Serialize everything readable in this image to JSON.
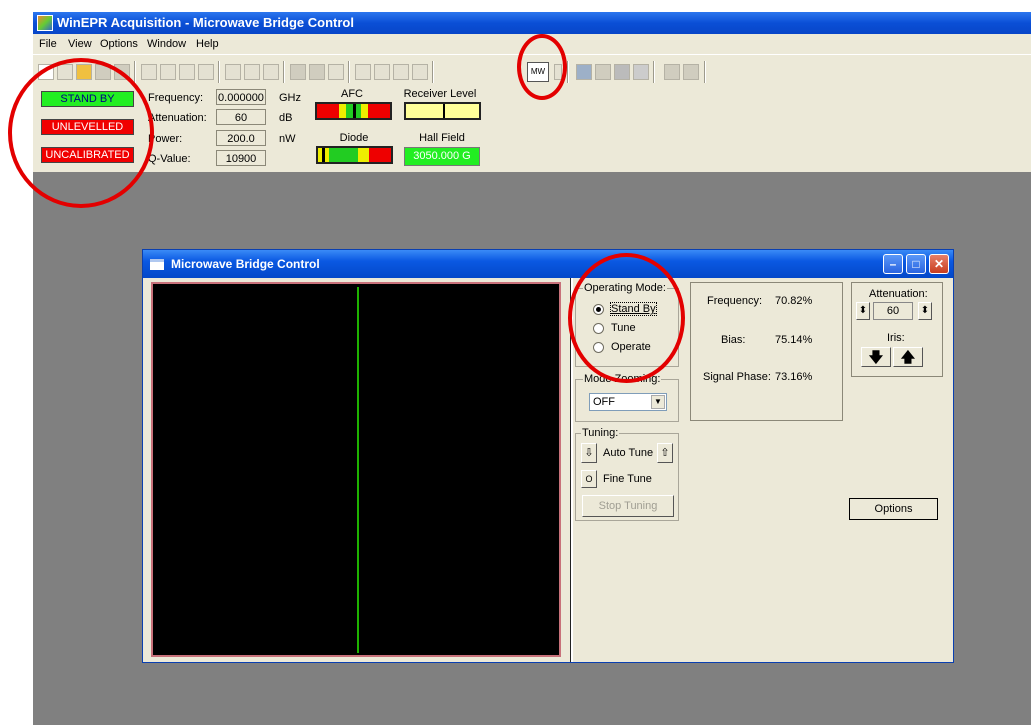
{
  "app": {
    "title": "WinEPR Acquisition - Microwave Bridge Control",
    "menu": [
      "File",
      "View",
      "Options",
      "Window",
      "Help"
    ]
  },
  "toolbar": {
    "mw_label": "MW"
  },
  "status": {
    "standby": "STAND BY",
    "unlevelled": "UNLEVELLED",
    "uncalibrated": "UNCALIBRATED",
    "colors": {
      "green": "#22ee22",
      "red": "#f00000"
    }
  },
  "params": [
    {
      "label": "Frequency:",
      "value": "0.000000",
      "unit": "GHz"
    },
    {
      "label": "Attenuation:",
      "value": "60",
      "unit": "dB"
    },
    {
      "label": "Power:",
      "value": "200.0",
      "unit": "nW"
    },
    {
      "label": "Q-Value:",
      "value": "10900",
      "unit": ""
    }
  ],
  "meters": {
    "afc": "AFC",
    "receiver_level": "Receiver Level",
    "diode": "Diode",
    "hall_field": "Hall Field",
    "hall_field_value": "3050.000 G"
  },
  "child": {
    "title": "Microwave Bridge Control",
    "operating_mode": {
      "label": "Operating Mode:",
      "options": [
        "Stand By",
        "Tune",
        "Operate"
      ],
      "selected": "Stand By"
    },
    "mode_zooming": {
      "label": "Mode Zooming:",
      "value": "OFF"
    },
    "readouts": [
      {
        "label": "Frequency:",
        "value": "70.82%"
      },
      {
        "label": "Bias:",
        "value": "75.14%"
      },
      {
        "label": "Signal Phase:",
        "value": "73.16%"
      }
    ],
    "attenuation": {
      "label": "Attenuation:",
      "value": "60",
      "iris_label": "Iris:"
    },
    "tuning": {
      "label": "Tuning:",
      "auto_tune": "Auto Tune",
      "fine_tune": "Fine Tune",
      "stop_tuning": "Stop Tuning"
    },
    "options_button": "Options"
  }
}
